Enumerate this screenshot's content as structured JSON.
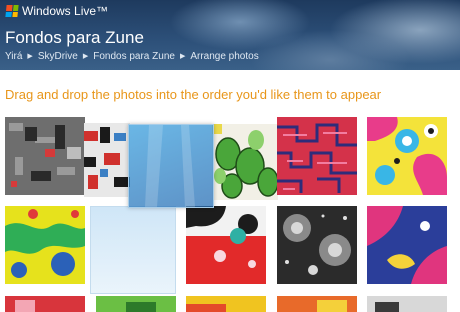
{
  "header": {
    "brand": "Windows Live™",
    "title": "Fondos para Zune",
    "breadcrumb": [
      "Yirá",
      "SkyDrive",
      "Fondos para Zune",
      "Arrange photos"
    ]
  },
  "instruction": "Drag and drop the photos into the order you'd like them to appear",
  "colors": {
    "instruction": "#e8961a",
    "header_bg": "#2c4f78"
  }
}
